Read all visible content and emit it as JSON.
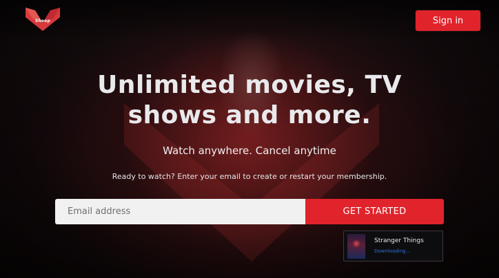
{
  "header": {
    "logo_text": "Sheep",
    "signin_label": "Sign in"
  },
  "hero": {
    "headline_line1": "Unlimited movies, TV",
    "headline_line2": "shows and more.",
    "subheadline": "Watch anywhere. Cancel anytime",
    "prompt": "Ready to watch? Enter your email to create or restart your membership."
  },
  "email_form": {
    "placeholder": "Email address",
    "value": "",
    "button_label": "GET STARTED"
  },
  "download_toast": {
    "title": "Stranger Things",
    "status": "Downloading..."
  },
  "colors": {
    "accent": "#e1232b",
    "text": "#e9e9ec",
    "status": "#2f6fd6"
  },
  "icons": {
    "logo": "fox-logo-icon",
    "toast_thumb": "poster-thumbnail"
  }
}
